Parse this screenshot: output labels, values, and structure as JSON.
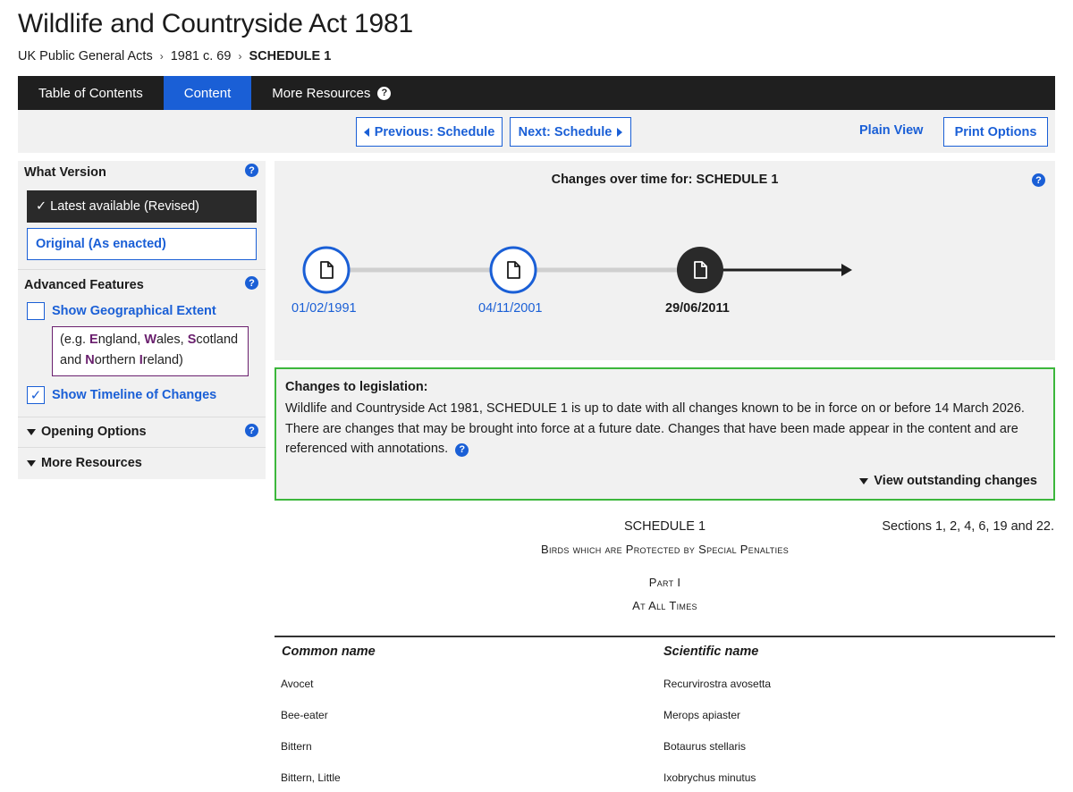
{
  "page": {
    "title": "Wildlife and Countryside Act 1981",
    "breadcrumb": [
      "UK Public General Acts",
      "1981 c. 69",
      "SCHEDULE 1"
    ]
  },
  "tabs": {
    "toc": "Table of Contents",
    "content": "Content",
    "more": "More Resources",
    "help": "?"
  },
  "nav": {
    "previous": "Previous: Schedule",
    "next": "Next: Schedule",
    "plain_view": "Plain View",
    "print_options": "Print Options"
  },
  "sidebar": {
    "what_version": "What Version",
    "latest": "Latest available (Revised)",
    "latest_check": "✓",
    "original": "Original (As enacted)",
    "advanced": "Advanced Features",
    "show_geo": "Show Geographical Extent",
    "geo_example": {
      "prefix": "(e.g. ",
      "e": "E",
      "ngland": "ngland, ",
      "w": "W",
      "ales": "ales, ",
      "s": "S",
      "cotland": "cotland",
      "and": "and ",
      "n": "N",
      "orthern": "orthern ",
      "i": "I",
      "reland": "reland)"
    },
    "show_timeline": "Show Timeline of Changes",
    "timeline_checked": "✓",
    "opening_options": "Opening Options",
    "more_resources": "More Resources",
    "help": "?"
  },
  "timeline": {
    "title": "Changes over time for: SCHEDULE 1",
    "help": "?",
    "points": [
      {
        "date": "01/02/1991",
        "current": false
      },
      {
        "date": "04/11/2001",
        "current": false
      },
      {
        "date": "29/06/2011",
        "current": true
      }
    ]
  },
  "changes": {
    "title": "Changes to legislation:",
    "body": "Wildlife and Countryside Act 1981, SCHEDULE 1 is up to date with all changes known to be in force on or before 14 March 2026. There are changes that may be brought into force at a future date. Changes that have been made appear in the content and are referenced with annotations.",
    "help": "?",
    "view_outstanding": "View outstanding changes"
  },
  "schedule": {
    "title": "SCHEDULE 1",
    "sections_ref": "Sections 1, 2, 4, 6, 19 and 22.",
    "subtitle": "Birds which are Protected by Special Penalties",
    "part": "Part I",
    "part_title": "At All Times"
  },
  "table": {
    "headers": [
      "Common name",
      "Scientific name"
    ],
    "rows": [
      [
        "Avocet",
        "Recurvirostra avosetta"
      ],
      [
        "Bee-eater",
        "Merops apiaster"
      ],
      [
        "Bittern",
        "Botaurus stellaris"
      ],
      [
        "Bittern, Little",
        "Ixobrychus minutus"
      ]
    ]
  },
  "colors": {
    "accent": "#1a5fd6",
    "dark_bar": "#1f1f1f",
    "panel": "#f1f1f1",
    "status_border": "#3cb73c",
    "geo_highlight": "#6a1f6e"
  }
}
